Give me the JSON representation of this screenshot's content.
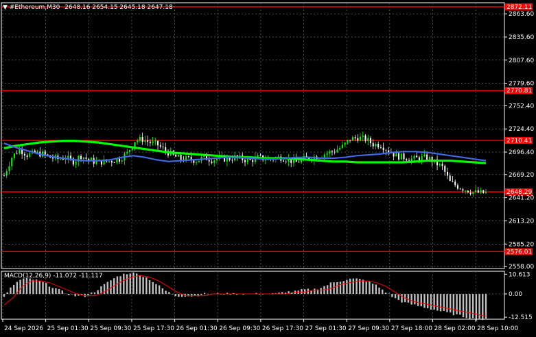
{
  "header": {
    "symbol_timeframe": "#Ethereum,M30",
    "ohlc": "2648.16 2654.15 2645.18 2647.18"
  },
  "price_axis": {
    "ticks": [
      "2863.60",
      "2835.60",
      "2807.60",
      "2779.60",
      "2752.40",
      "2724.40",
      "2696.40",
      "2669.20",
      "2641.20",
      "2613.20",
      "2585.20",
      "2558.00"
    ],
    "tick_values": [
      2863.6,
      2835.6,
      2807.6,
      2779.6,
      2752.4,
      2724.4,
      2696.4,
      2669.2,
      2641.2,
      2613.2,
      2585.2,
      2558.0
    ],
    "range": [
      2555.6,
      2877.0
    ]
  },
  "levels": [
    {
      "label": "2872.11",
      "value": 2872.11
    },
    {
      "label": "2770.81",
      "value": 2770.81
    },
    {
      "label": "2710.41",
      "value": 2710.41
    },
    {
      "label": "2648.29",
      "value": 2648.29
    },
    {
      "label": "2576.01",
      "value": 2576.01
    }
  ],
  "macd": {
    "title": "MACD(12,26,9) -11.072 -11.117",
    "ticks": [
      "10.613",
      "0.00",
      "-12.515"
    ],
    "tick_values": [
      10.613,
      0.0,
      -12.515
    ]
  },
  "time_axis": [
    "24 Sep 2026",
    "25 Sep 01:30",
    "25 Sep 09:30",
    "25 Sep 17:30",
    "26 Sep 01:30",
    "26 Sep 09:30",
    "26 Sep 17:30",
    "27 Sep 01:30",
    "27 Sep 09:30",
    "27 Sep 18:00",
    "28 Sep 02:00",
    "28 Sep 10:00"
  ],
  "colors": {
    "background": "#000000",
    "bull_candle": "#00ff00",
    "bear_candle": "#ffffff",
    "level_line": "#ff0000",
    "ma_fast": "#4169e1",
    "ma_slow": "#00ff00",
    "macd_hist": "#c0c0c0",
    "macd_signal": "#ff0000",
    "grid": "#808080"
  },
  "chart_data": {
    "type": "candlestick",
    "series": [
      {
        "name": "price",
        "values": [
          2668,
          2690,
          2700,
          2693,
          2695,
          2694,
          2690,
          2688,
          2690,
          2685,
          2692,
          2687,
          2684,
          2685,
          2686,
          2688,
          2695,
          2710,
          2712,
          2708,
          2705,
          2698,
          2692,
          2688,
          2688,
          2686,
          2690,
          2687,
          2689,
          2688,
          2690,
          2688,
          2686,
          2690,
          2688,
          2689,
          2690,
          2687,
          2684,
          2688,
          2690,
          2692,
          2695,
          2698,
          2703,
          2712,
          2714,
          2712,
          2706,
          2705,
          2698,
          2692,
          2690,
          2688,
          2689,
          2690,
          2684,
          2678,
          2660,
          2655,
          2651,
          2648,
          2647
        ]
      },
      {
        "name": "ma-fast",
        "values": [
          2707,
          2702,
          2698,
          2694,
          2691,
          2689,
          2687,
          2686,
          2686,
          2687,
          2690,
          2692,
          2690,
          2687,
          2685,
          2686,
          2687,
          2688,
          2689,
          2690,
          2690,
          2689,
          2688,
          2688,
          2689,
          2690,
          2690,
          2689,
          2689,
          2690,
          2692,
          2693,
          2694,
          2696,
          2697,
          2697,
          2696,
          2694,
          2692,
          2690,
          2688,
          2686
        ]
      },
      {
        "name": "ma-slow",
        "values": [
          2701,
          2704,
          2706,
          2708,
          2709,
          2710,
          2710,
          2709,
          2708,
          2706,
          2704,
          2702,
          2700,
          2698,
          2696,
          2695,
          2694,
          2693,
          2692,
          2691,
          2690,
          2690,
          2689,
          2689,
          2689,
          2688,
          2687,
          2686,
          2685,
          2685,
          2684,
          2684,
          2684,
          2684,
          2684,
          2685,
          2686,
          2686,
          2686,
          2685,
          2684,
          2683
        ]
      },
      {
        "name": "macd-signal",
        "values": [
          -6,
          -2,
          4,
          7,
          7,
          6,
          4,
          2,
          0,
          -1,
          -1,
          1,
          4,
          7,
          9,
          10,
          9,
          7,
          4,
          1,
          -1,
          -1,
          -1,
          0,
          0,
          0,
          0,
          0,
          0,
          0,
          0,
          0,
          1,
          1,
          2,
          2,
          3,
          5,
          6,
          7,
          7,
          6,
          4,
          1,
          -2,
          -4,
          -5,
          -6,
          -7,
          -8,
          -9,
          -10,
          -11,
          -12
        ]
      }
    ]
  }
}
